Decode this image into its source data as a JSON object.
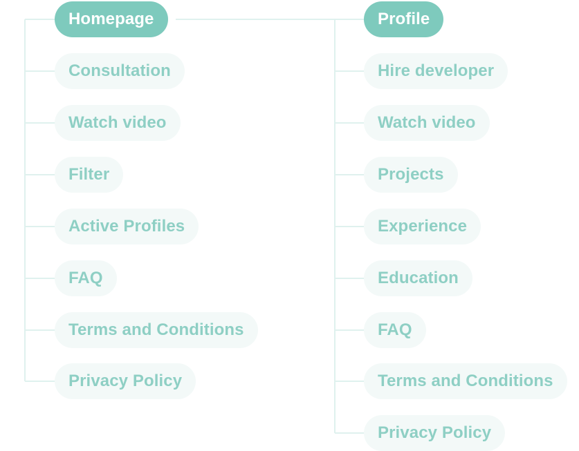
{
  "colors": {
    "root_fill": "#7ecabd",
    "root_text": "#ffffff",
    "item_fill": "#f3f9f8",
    "item_text": "#8ecfc4",
    "connector": "#dff1ee"
  },
  "left_tree": {
    "root": "Homepage",
    "items": [
      "Consultation",
      "Watch video",
      "Filter",
      "Active Profiles",
      "FAQ",
      "Terms and Conditions",
      "Privacy Policy"
    ]
  },
  "right_tree": {
    "root": "Profile",
    "items": [
      "Hire developer",
      "Watch video",
      "Projects",
      "Experience",
      "Education",
      "FAQ",
      "Terms and Conditions",
      "Privacy Policy"
    ]
  }
}
